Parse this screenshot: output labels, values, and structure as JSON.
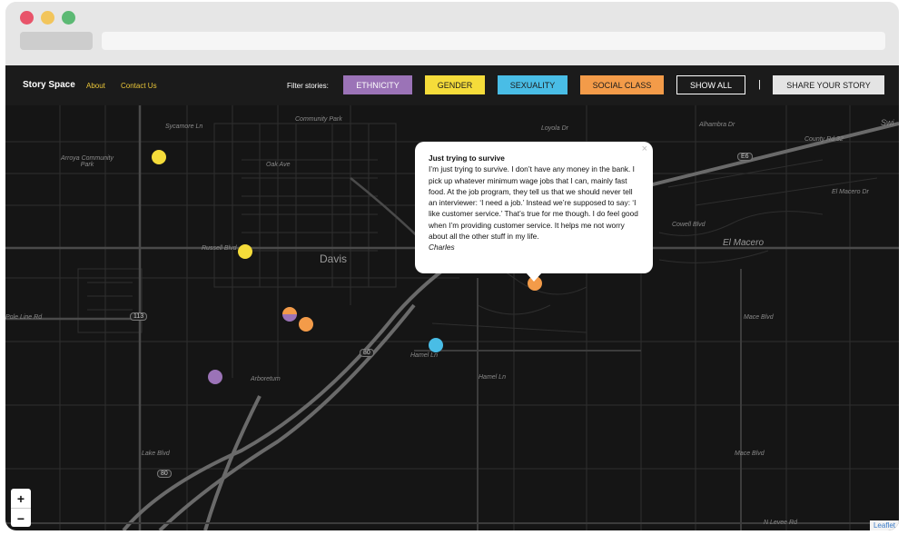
{
  "window": {
    "traffic_lights": [
      "#e8546a",
      "#f2c55c",
      "#5cb974"
    ]
  },
  "nav": {
    "brand": "Story Space",
    "links": [
      "About",
      "Contact Us"
    ],
    "filter_label": "Filter stories:",
    "filters": [
      {
        "label": "ETHNICITY",
        "color": "#9b73b7"
      },
      {
        "label": "GENDER",
        "color": "#f5dc3a"
      },
      {
        "label": "SEXUALITY",
        "color": "#49bde6"
      },
      {
        "label": "SOCIAL CLASS",
        "color": "#f39b49"
      }
    ],
    "show_all": "SHOW ALL",
    "separator": "|",
    "share": "SHARE YOUR STORY"
  },
  "map": {
    "labels": [
      "Community Park",
      "Arroya Community Park",
      "Arboretum",
      "Davis",
      "El Macero",
      "Hamel Ln",
      "N Levee Rd",
      "Swi",
      "Alhambra Dr",
      "County Rd 32",
      "E6",
      "Russell Blvd",
      "Sycamore Ln",
      "Oak Ave",
      "Lake Blvd",
      "Hamel Ln",
      "Mace Blvd",
      "Mace Blvd",
      "Cowell Blvd",
      "El Macero Dr",
      "Loyola Dr",
      "Pole Line Rd",
      "113",
      "80",
      "80"
    ],
    "markers": [
      {
        "category": "gender",
        "color": "#f5dc3a"
      },
      {
        "category": "gender",
        "color": "#f5dc3a"
      },
      {
        "category": "ethnicity-social-class",
        "color": "#9b73b7"
      },
      {
        "category": "social-class",
        "color": "#f39b49"
      },
      {
        "category": "ethnicity",
        "color": "#9b73b7"
      },
      {
        "category": "sexuality",
        "color": "#49bde6"
      },
      {
        "category": "social-class",
        "color": "#f39b49"
      }
    ]
  },
  "popup": {
    "title": "Just trying to survive",
    "body": "I’m just trying to survive. I don’t have any money in the bank. I pick up whatever minimum wage jobs that I can, mainly fast food. At the job program, they tell us that we should never tell an interviewer: ‘I need a job.’ Instead we’re supposed to say: ‘I like customer service.’ That’s true for me though. I do feel good when I’m providing customer service. It helps me not worry about all the other stuff in my life.",
    "author": "Charles",
    "close": "×"
  },
  "zoom": {
    "in": "+",
    "out": "−"
  },
  "attribution": "Leaflet"
}
